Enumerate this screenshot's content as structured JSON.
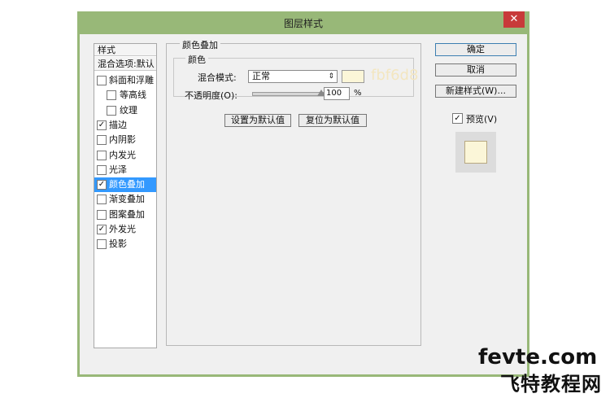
{
  "window": {
    "title": "图层样式",
    "close_glyph": "✕"
  },
  "styles_panel": {
    "header": "样式",
    "blend_options": "混合选项:默认",
    "items": [
      {
        "label": "斜面和浮雕",
        "checked": false,
        "indent": false,
        "selected": false
      },
      {
        "label": "等高线",
        "checked": false,
        "indent": true,
        "selected": false
      },
      {
        "label": "纹理",
        "checked": false,
        "indent": true,
        "selected": false
      },
      {
        "label": "描边",
        "checked": true,
        "indent": false,
        "selected": false
      },
      {
        "label": "内阴影",
        "checked": false,
        "indent": false,
        "selected": false
      },
      {
        "label": "内发光",
        "checked": false,
        "indent": false,
        "selected": false
      },
      {
        "label": "光泽",
        "checked": false,
        "indent": false,
        "selected": false
      },
      {
        "label": "颜色叠加",
        "checked": true,
        "indent": false,
        "selected": true
      },
      {
        "label": "渐变叠加",
        "checked": false,
        "indent": false,
        "selected": false
      },
      {
        "label": "图案叠加",
        "checked": false,
        "indent": false,
        "selected": false
      },
      {
        "label": "外发光",
        "checked": true,
        "indent": false,
        "selected": false
      },
      {
        "label": "投影",
        "checked": false,
        "indent": false,
        "selected": false
      }
    ]
  },
  "color_overlay": {
    "group_title": "颜色叠加",
    "sub_title": "颜色",
    "blend_mode_label": "混合模式:",
    "blend_mode_value": "正常",
    "swatch_color": "#fbf6d8",
    "hex_label": "fbf6d8",
    "opacity_label": "不透明度(O):",
    "opacity_value": "100",
    "opacity_unit": "%",
    "opacity_fraction": 1.0,
    "make_default": "设置为默认值",
    "reset_default": "复位为默认值"
  },
  "buttons": {
    "ok": "确定",
    "cancel": "取消",
    "new_style": "新建样式(W)...",
    "preview_label": "预览(V)",
    "preview_checked": true
  },
  "watermark": {
    "line1": "fevte.com",
    "line2": "飞特教程网"
  }
}
